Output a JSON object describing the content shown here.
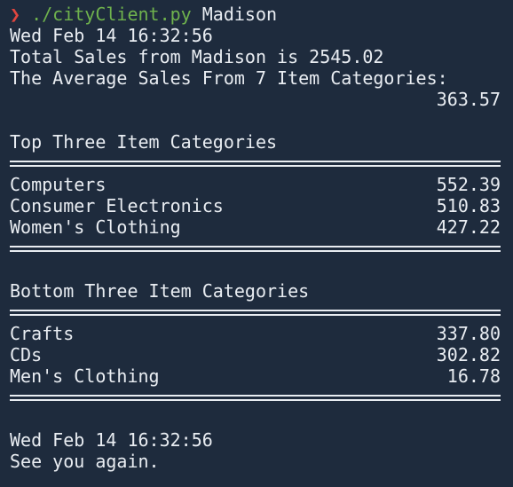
{
  "prompt": {
    "arrow": "❯",
    "command": "./cityClient.py",
    "argument": "Madison"
  },
  "header": {
    "timestamp": "Wed Feb 14 16:32:56",
    "total_sales_line": "Total Sales from Madison is 2545.02",
    "average_line": "The Average Sales From 7 Item Categories:",
    "average_value": "363.57"
  },
  "top": {
    "title": "Top Three Item Categories",
    "rows": [
      {
        "category": "Computers",
        "value": "552.39"
      },
      {
        "category": "Consumer Electronics",
        "value": "510.83"
      },
      {
        "category": "Women's Clothing",
        "value": "427.22"
      }
    ]
  },
  "bottom": {
    "title": "Bottom Three Item Categories",
    "rows": [
      {
        "category": "Crafts",
        "value": "337.80"
      },
      {
        "category": "CDs",
        "value": "302.82"
      },
      {
        "category": "Men's Clothing",
        "value": "16.78"
      }
    ]
  },
  "footer": {
    "timestamp": "Wed Feb 14 16:32:56",
    "farewell": "See you again."
  },
  "colors": {
    "background": "#1e2b3d",
    "text": "#e9edf2",
    "prompt_arrow": "#e0463f",
    "command": "#6fb24d"
  }
}
